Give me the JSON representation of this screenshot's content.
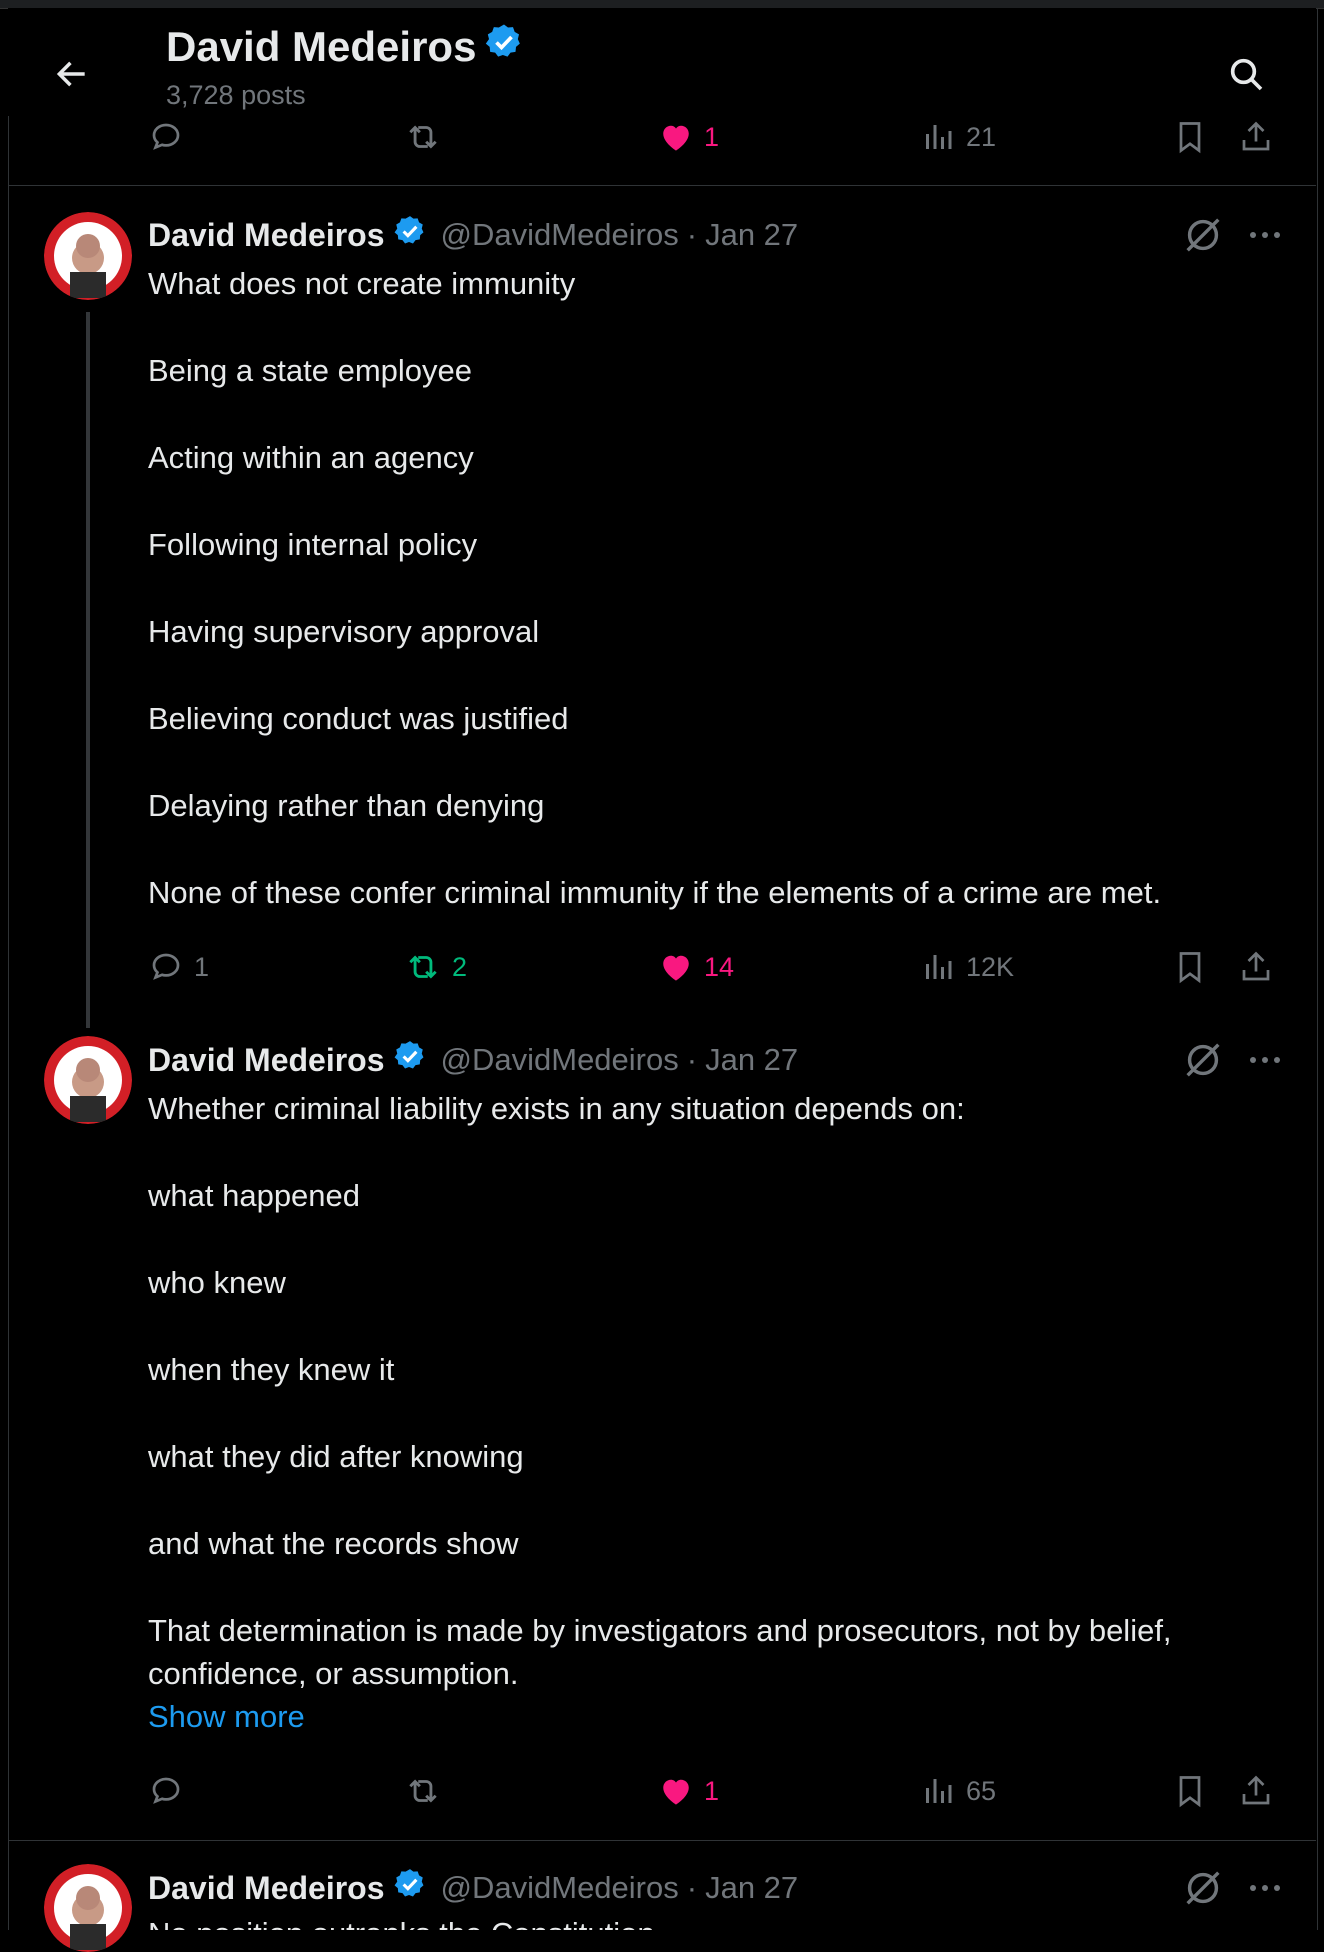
{
  "header": {
    "name": "David Medeiros",
    "posts": "3,728 posts"
  },
  "prev_post_actions": {
    "replies": "",
    "reposts": "",
    "likes": "1",
    "views": "21"
  },
  "posts": [
    {
      "name": "David Medeiros",
      "handle": "@DavidMedeiros",
      "date": "Jan 27",
      "lines": [
        "What does not create immunity",
        "Being a state employee",
        "Acting within an agency",
        "Following internal policy",
        "Having supervisory approval",
        "Believing conduct was justified",
        "Delaying rather than denying",
        "None of these confer criminal immunity if the elements of a crime are met."
      ],
      "actions": {
        "replies": "1",
        "reposts": "2",
        "likes": "14",
        "views": "12K"
      }
    },
    {
      "name": "David Medeiros",
      "handle": "@DavidMedeiros",
      "date": "Jan 27",
      "lines": [
        "Whether criminal liability exists in any situation depends on:",
        "what happened",
        "who knew",
        "when they knew it",
        "what they did after knowing",
        "and what the records show",
        "That determination is made by investigators and prosecutors, not by belief, confidence, or assumption."
      ],
      "show_more": "Show more",
      "actions": {
        "replies": "",
        "reposts": "",
        "likes": "1",
        "views": "65"
      }
    },
    {
      "name": "David Medeiros",
      "handle": "@DavidMedeiros",
      "date": "Jan 27",
      "partial_text": "No position outranks the Constitution"
    }
  ],
  "colors": {
    "like": "#f91880",
    "repost": "#00ba7c",
    "link": "#1d9bf0",
    "verified": "#1d9bf0",
    "muted": "#71767b"
  }
}
